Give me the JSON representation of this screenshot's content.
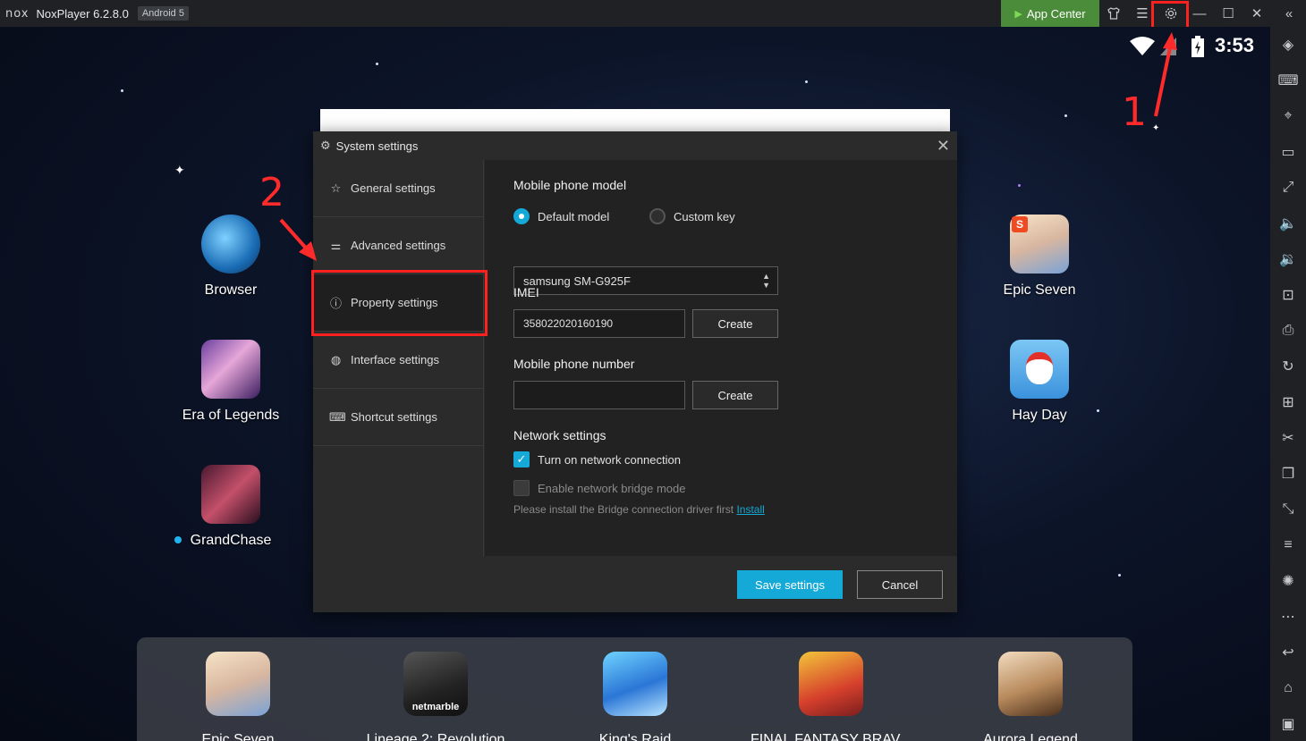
{
  "titlebar": {
    "logo": "nox",
    "app_title": "NoxPlayer 6.2.8.0",
    "android_badge": "Android 5",
    "app_center": "App Center"
  },
  "status": {
    "time": "3:53"
  },
  "desktop_apps": {
    "browser": "Browser",
    "era": "Era of Legends",
    "grandchase": "GrandChase",
    "epic": "Epic Seven",
    "hayday": "Hay Day"
  },
  "dock_apps": {
    "a1": "Epic Seven",
    "a2": "Lineage 2: Revolution",
    "a3": "King's Raid",
    "a4": "FINAL FANTASY BRAV…",
    "a5": "Aurora Legend"
  },
  "dialog": {
    "title": "System settings",
    "sidebar": {
      "general": "General settings",
      "advanced": "Advanced settings",
      "property": "Property settings",
      "interface": "Interface settings",
      "shortcut": "Shortcut settings"
    },
    "model_title": "Mobile phone model",
    "radio_default": "Default model",
    "radio_custom": "Custom key",
    "model_value": "samsung SM-G925F",
    "imei_title": "IMEI",
    "imei_value": "358022020160190",
    "create_label": "Create",
    "phone_title": "Mobile phone number",
    "phone_value": "",
    "network_title": "Network settings",
    "network_on": "Turn on network connection",
    "network_bridge": "Enable network bridge mode",
    "note_text": "Please install the Bridge connection driver first ",
    "note_link": "Install",
    "save_label": "Save settings",
    "cancel_label": "Cancel"
  },
  "annotations": {
    "n1": "1",
    "n2": "2"
  },
  "colors": {
    "accent": "#14a9d6",
    "highlight": "#ff2020",
    "app_center": "#4a8c3a"
  }
}
